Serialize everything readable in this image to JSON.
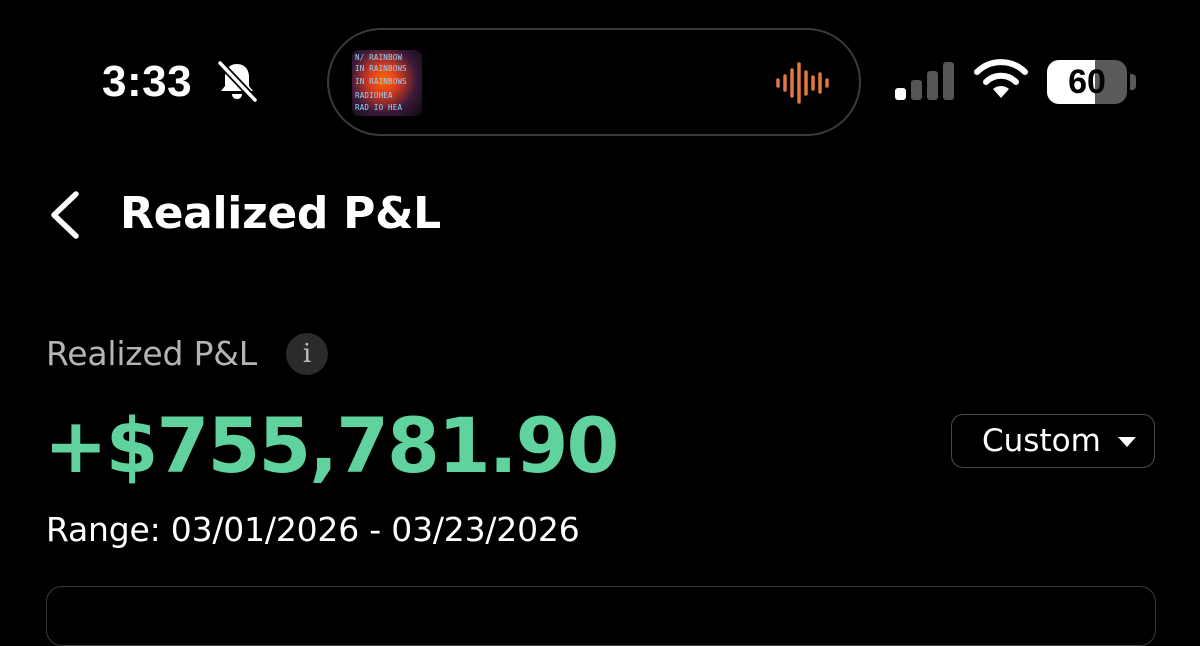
{
  "status_bar": {
    "time": "3:33",
    "battery_level": "60",
    "battery_fraction": 0.6,
    "icons": [
      "bell-off-icon",
      "signal-icon",
      "wifi-icon",
      "battery-icon"
    ]
  },
  "now_playing": {
    "album_art_lines": [
      "N/ RAINBOW",
      "IN RAINBOWS",
      "IN RAINBOWS",
      "RADIOHEA",
      "RAD IO HEA"
    ],
    "waveform_color": "#e0793a"
  },
  "header": {
    "title": "Realized P&L",
    "back_icon": "chevron-left-icon"
  },
  "summary": {
    "label": "Realized P&L",
    "info_icon_glyph": "i",
    "value": "+$755,781.90",
    "value_color": "#5fd29d",
    "range_text": "Range: 03/01/2026 - 03/23/2026",
    "range_selector": {
      "selected": "Custom"
    }
  }
}
